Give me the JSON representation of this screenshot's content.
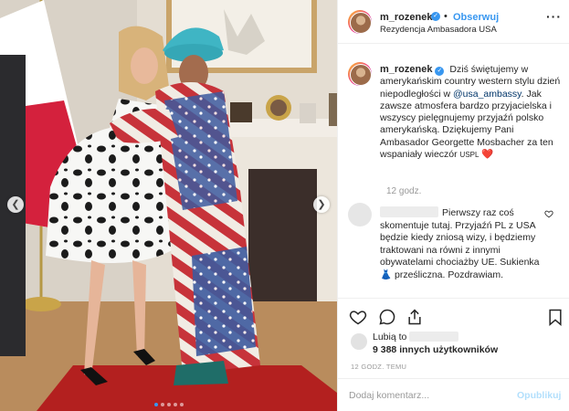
{
  "post": {
    "username": "m_rozenek",
    "follow_label": "Obserwuj",
    "separator": "•",
    "location": "Rezydencja Ambasadora USA",
    "more_icon": "more-options-icon",
    "caption": {
      "username": "m_rozenek",
      "text_before_mention": "Dziś świętujemy w amerykańskim country western stylu dzień niepodległości w",
      "mention": "@usa_ambassy",
      "text_after_mention": ". Jak zawsze atmosfera bardzo przyjacielska i wszyscy pielęgnujemy przyjaźń polsko amerykańską. Dziękujemy Pani Ambasador Georgette Mosbacher za ten wspaniały wieczór",
      "flag_text": "USPL",
      "heart": "❤️"
    },
    "caption_time": "12 godz.",
    "comment": {
      "text": "Pierwszy raz coś skomentuje tutaj. Przyjaźń PL z USA będzie kiedy zniosą wizy, i będziemy traktowani na równi z innymi obywatelami chociażby UE. Sukienka 👗 prześliczna. Pozdrawiam."
    },
    "likes": {
      "prefix": "Lubią to",
      "count_line": "9 388 innych użytkowników"
    },
    "date": "12 GODZ. TEMU",
    "add_comment_placeholder": "Dodaj komentarz...",
    "publish_label": "Opublikuj"
  },
  "carousel": {
    "slides": 5,
    "active": 1
  },
  "colors": {
    "accent": "#3897f0",
    "like_red": "#ed4956",
    "border": "#efefef"
  }
}
